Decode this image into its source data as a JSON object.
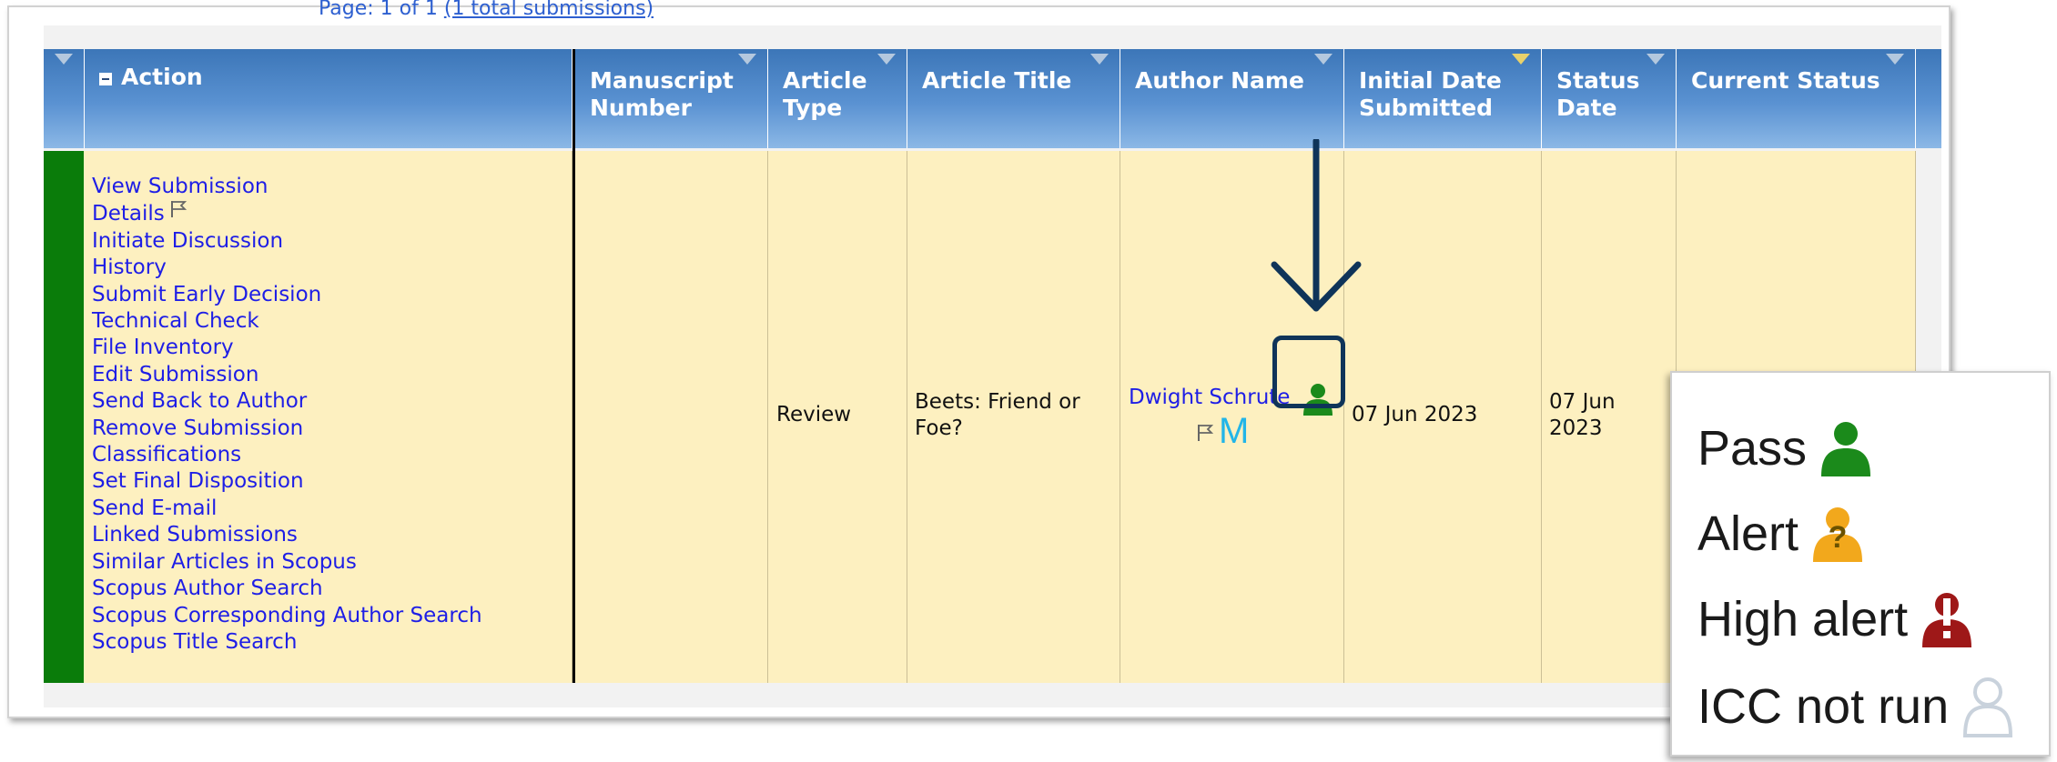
{
  "pager": {
    "text": "Page: 1 of 1",
    "link_text": "(1 total submissions)"
  },
  "table": {
    "columns": [
      {
        "key": "action",
        "label": "Action"
      },
      {
        "key": "manuscript_number",
        "label": "Manuscript Number"
      },
      {
        "key": "article_type",
        "label": "Article Type"
      },
      {
        "key": "article_title",
        "label": "Article Title"
      },
      {
        "key": "author_name",
        "label": "Author Name"
      },
      {
        "key": "initial_date_submitted",
        "label": "Initial Date Submitted"
      },
      {
        "key": "status_date",
        "label": "Status Date"
      },
      {
        "key": "current_status",
        "label": "Current Status"
      }
    ],
    "sorted_column": "initial_date_submitted",
    "row": {
      "status_color": "#0a7c0a",
      "actions": [
        "View Submission",
        "Details",
        "Initiate Discussion",
        "History",
        "Submit Early Decision",
        "Technical Check",
        "File Inventory",
        "Edit Submission",
        "Send Back to Author",
        "Remove Submission",
        "Classifications",
        "Set Final Disposition",
        "Send E-mail",
        "Linked Submissions",
        "Similar Articles in Scopus",
        "Scopus Author Search",
        "Scopus Corresponding Author Search",
        "Scopus Title Search"
      ],
      "manuscript_number": "",
      "article_type": "Review",
      "article_title": "Beets: Friend or Foe?",
      "author_name": "Dwight Schrute",
      "author_badge": "M",
      "author_icc_status": "Pass",
      "initial_date_submitted": "07 Jun 2023",
      "status_date": "07 Jun 2023",
      "current_status": ""
    }
  },
  "legend": {
    "items": [
      {
        "label": "Pass",
        "icon": "person-pass-icon",
        "color": "#1b8a1b"
      },
      {
        "label": "Alert",
        "icon": "person-alert-icon",
        "color": "#f2a81c"
      },
      {
        "label": "High alert",
        "icon": "person-high-alert-icon",
        "color": "#9e1818"
      },
      {
        "label": "ICC not run",
        "icon": "person-not-run-icon",
        "color": "#c9d2dc"
      }
    ]
  },
  "colors": {
    "header": "#4a86c8",
    "row_background": "#fdf0c0",
    "link": "#1e1ee6",
    "callout": "#0f3459"
  }
}
